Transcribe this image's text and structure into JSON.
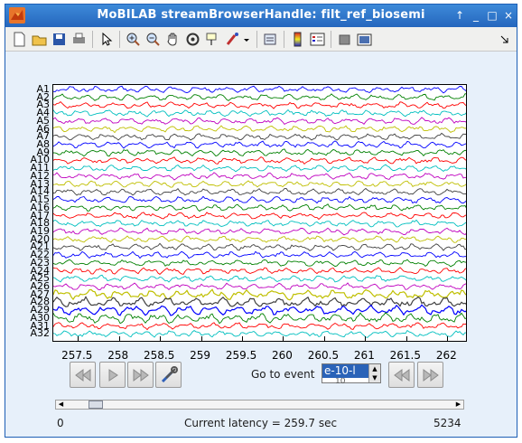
{
  "window": {
    "title": "MoBILAB streamBrowserHandle: filt_ref_biosemi"
  },
  "toolbar": {
    "icons": [
      "new-file-icon",
      "open-folder-icon",
      "save-icon",
      "print-icon",
      "pointer-icon",
      "zoom-in-icon",
      "zoom-out-icon",
      "pan-icon",
      "rotate-3d-icon",
      "data-cursor-icon",
      "brush-icon",
      "link-icon",
      "colorbar-icon",
      "legend-icon",
      "hide-plot-tools-icon",
      "show-plot-tools-icon"
    ]
  },
  "plot": {
    "channels": [
      "A1",
      "A2",
      "A3",
      "A4",
      "A5",
      "A6",
      "A7",
      "A8",
      "A9",
      "A10",
      "A11",
      "A12",
      "A13",
      "A14",
      "A15",
      "A16",
      "A17",
      "A18",
      "A19",
      "A20",
      "A21",
      "A22",
      "A23",
      "A24",
      "A25",
      "A26",
      "A27",
      "A28",
      "A29",
      "A30",
      "A31",
      "A32"
    ],
    "channel_colors": [
      "#0000ff",
      "#008000",
      "#ff0000",
      "#00bfbf",
      "#bf00bf",
      "#bfbf00",
      "#404040"
    ],
    "x_ticks": [
      "257.5",
      "258",
      "258.5",
      "259",
      "259.5",
      "260",
      "260.5",
      "261",
      "261.5",
      "262"
    ],
    "x_range": [
      257.2,
      262.25
    ]
  },
  "controls": {
    "goto_label": "Go to event",
    "event_value": "e-10-l",
    "event_next": "10"
  },
  "scroll": {
    "position_fraction": 0.06
  },
  "footer": {
    "min": "0",
    "latency": "Current latency = 259.7 sec",
    "max": "5234"
  }
}
